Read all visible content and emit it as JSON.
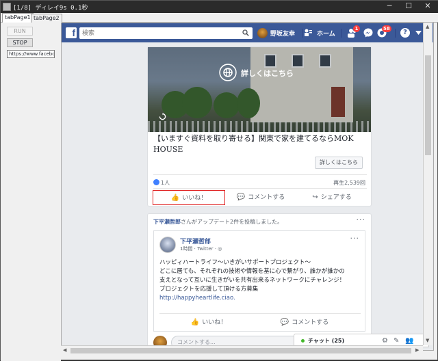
{
  "window": {
    "title": "[1/8] ディレイ9s 0.1秒",
    "controls": {
      "minimize": "─",
      "maximize": "☐",
      "close": "✕"
    }
  },
  "tabs": [
    {
      "label": "tabPage1",
      "active": true
    },
    {
      "label": "tabPage2",
      "active": false
    }
  ],
  "left_panel": {
    "run_label": "RUN",
    "stop_label": "STOP",
    "url_value": "https://www.facebook.com"
  },
  "facebook": {
    "logo": "f",
    "search_placeholder": "検索",
    "user_name": "野坂友幸",
    "home_label": "ホーム",
    "friend_badge": "1",
    "notif_badge": "58",
    "help_icon": "?",
    "ad": {
      "overlay_cta": "詳しくはこちら",
      "title": "【いますぐ資料を取り寄せる】関東で家を建てるならMOK HOUSE",
      "learn_more": "詳しくはこちら",
      "likes": "1人",
      "views": "再生2,539回",
      "actions": {
        "like": "いいね！",
        "comment": "コメントする",
        "share": "シェアする"
      }
    },
    "post": {
      "header_name": "下平瀬哲郎",
      "header_text": "さんがアップデート2件を投稿しました。",
      "inner_name": "下平瀬哲郎",
      "inner_meta": "1時間 · Twitter · ",
      "body_lines": [
        "ハッピィハートライフ〜いきがいサポートプロジェクト〜",
        "どこに居ても、それぞれの技術や情報を基に心で繋がり、誰かが誰かの",
        "支えとなって互いに生きがいを共有出来るネットワークにチャレンジ！",
        "プロジェクトを応援して頂ける方募集"
      ],
      "link": "http://happyheartlife.ciao.",
      "actions": {
        "like": "いいね！",
        "comment": "コメントする"
      },
      "comment_placeholder": "コメントする..."
    },
    "chat": {
      "label": "チャット (25)"
    }
  },
  "colors": {
    "facebook_blue": "#3b5998",
    "link_blue": "#385898",
    "badge_red": "#fa3e3e",
    "highlight_red": "#e02020",
    "online_green": "#42b72a"
  }
}
